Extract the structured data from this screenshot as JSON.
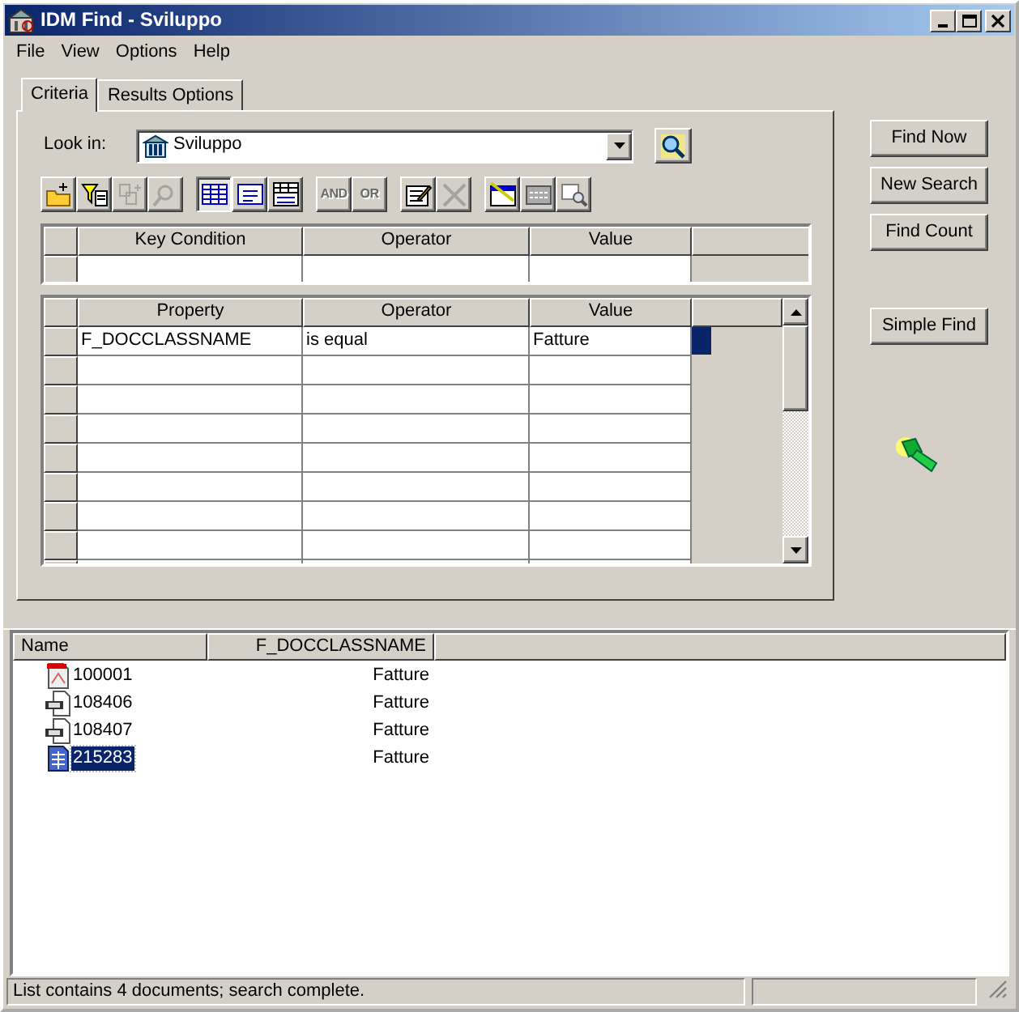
{
  "window": {
    "title": "IDM Find  - Sviluppo"
  },
  "menu": [
    {
      "label": "File"
    },
    {
      "label": "View"
    },
    {
      "label": "Options"
    },
    {
      "label": "Help"
    }
  ],
  "tabs": [
    {
      "label": "Criteria",
      "selected": true
    },
    {
      "label": "Results Options",
      "selected": false
    }
  ],
  "look_in": {
    "label": "Look in:",
    "value": "Sviluppo"
  },
  "toolbar": [
    {
      "kind": "folder-add",
      "disabled": false,
      "pressed": false
    },
    {
      "kind": "filter",
      "disabled": false,
      "pressed": false
    },
    {
      "kind": "copy",
      "disabled": true,
      "pressed": false
    },
    {
      "kind": "find",
      "disabled": true,
      "pressed": false
    },
    {
      "kind": "grid",
      "disabled": false,
      "pressed": true
    },
    {
      "kind": "list",
      "disabled": false,
      "pressed": false
    },
    {
      "kind": "details",
      "disabled": false,
      "pressed": false
    },
    {
      "kind": "text",
      "label": "AND",
      "disabled": true,
      "pressed": false
    },
    {
      "kind": "text",
      "label": "OR",
      "disabled": true,
      "pressed": false
    },
    {
      "kind": "edit",
      "disabled": false,
      "pressed": false
    },
    {
      "kind": "delete",
      "disabled": true,
      "pressed": false
    },
    {
      "kind": "select",
      "disabled": false,
      "pressed": false
    },
    {
      "kind": "fields",
      "disabled": false,
      "pressed": false
    },
    {
      "kind": "preview",
      "disabled": false,
      "pressed": false
    }
  ],
  "key_grid": {
    "columns": [
      "Key Condition",
      "Operator",
      "Value"
    ]
  },
  "property_grid": {
    "columns": [
      "Property",
      "Operator",
      "Value"
    ],
    "rows": [
      {
        "cells": [
          "F_DOCCLASSNAME",
          "is equal",
          "Fatture"
        ],
        "selected": true
      }
    ]
  },
  "buttons": [
    "Find Now",
    "New Search",
    "Find Count",
    "Simple Find"
  ],
  "results": {
    "columns": [
      "Name",
      "F_DOCCLASSNAME"
    ],
    "rows": [
      {
        "name": "100001",
        "doc_class": "Fatture",
        "kind": "pdf",
        "selected": false
      },
      {
        "name": "108406",
        "doc_class": "Fatture",
        "kind": "scan",
        "selected": false
      },
      {
        "name": "108407",
        "doc_class": "Fatture",
        "kind": "scan",
        "selected": false
      },
      {
        "name": "215283",
        "doc_class": "Fatture",
        "kind": "note",
        "selected": true
      }
    ]
  },
  "status_bar": {
    "text": "List contains 4 documents; search complete."
  }
}
